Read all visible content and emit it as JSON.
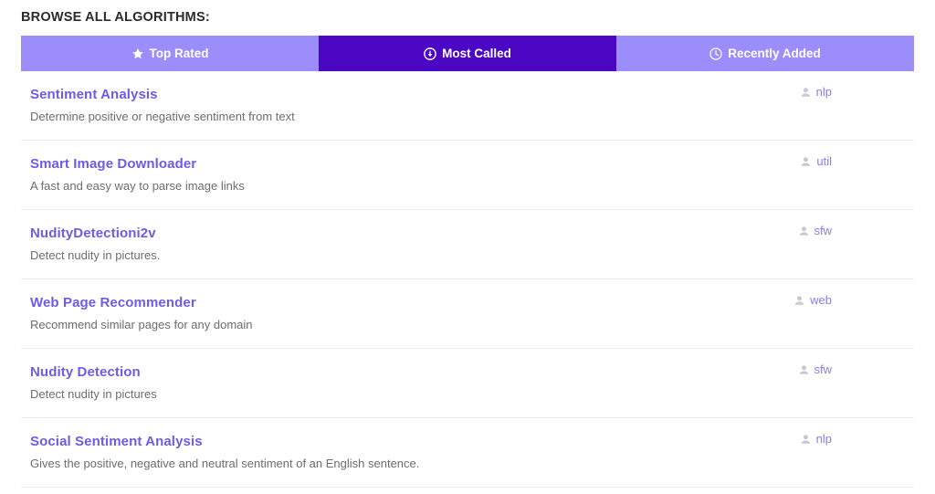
{
  "heading": "BROWSE ALL ALGORITHMS:",
  "colors": {
    "tab_inactive": "#9b8dfa",
    "tab_active": "#4c07c4",
    "tab_text": "#ffffff",
    "title_link": "#6c5ce7",
    "description": "#6d6d72",
    "author_link": "#8a7cf0",
    "author_icon": "#c8c8cf",
    "row_divider": "#ececf0",
    "page_background": "#ffffff",
    "heading_text": "#2b2b2b"
  },
  "tabs": [
    {
      "label": "Top Rated",
      "icon": "star-icon",
      "active": false
    },
    {
      "label": "Most Called",
      "icon": "circle-down-arrow-icon",
      "active": true
    },
    {
      "label": "Recently Added",
      "icon": "clock-icon",
      "active": false
    }
  ],
  "algorithms": [
    {
      "title": "Sentiment Analysis",
      "description": "Determine positive or negative sentiment from text",
      "author": "nlp"
    },
    {
      "title": "Smart Image Downloader",
      "description": "A fast and easy way to parse image links",
      "author": "util"
    },
    {
      "title": "NudityDetectioni2v",
      "description": "Detect nudity in pictures.",
      "author": "sfw"
    },
    {
      "title": "Web Page Recommender",
      "description": "Recommend similar pages for any domain",
      "author": "web"
    },
    {
      "title": "Nudity Detection",
      "description": "Detect nudity in pictures",
      "author": "sfw"
    },
    {
      "title": "Social Sentiment Analysis",
      "description": "Gives the positive, negative and neutral sentiment of an English sentence.",
      "author": "nlp"
    }
  ]
}
